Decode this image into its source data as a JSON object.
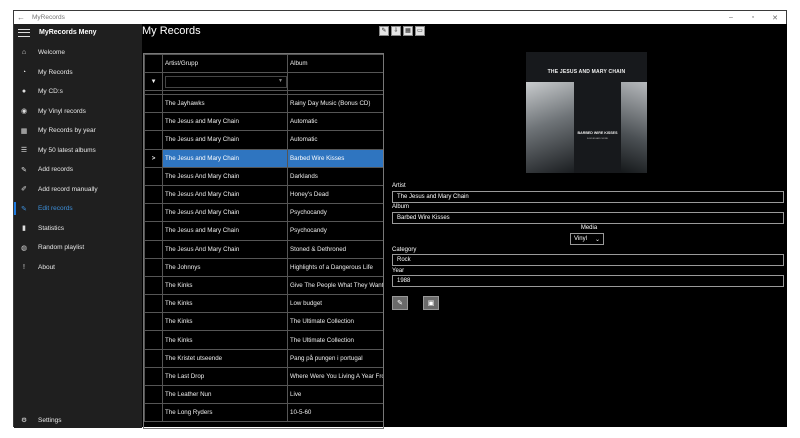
{
  "window": {
    "title": "MyRecords",
    "back_glyph": "←",
    "minimize_glyph": "–",
    "maximize_glyph": "▫",
    "close_glyph": "✕"
  },
  "sidebar": {
    "title": "MyRecords Meny",
    "items": [
      {
        "label": "Welcome",
        "icon": "home-icon",
        "glyph": "⌂"
      },
      {
        "label": "My Records",
        "icon": "records-icon",
        "glyph": "◔"
      },
      {
        "label": "My CD:s",
        "icon": "cd-icon",
        "glyph": "●"
      },
      {
        "label": "My Vinyl records",
        "icon": "vinyl-icon",
        "glyph": "◉"
      },
      {
        "label": "My Records by year",
        "icon": "calendar-icon",
        "glyph": "▦"
      },
      {
        "label": "My 50 latest albums",
        "icon": "list-icon",
        "glyph": "☰"
      },
      {
        "label": "Add records",
        "icon": "pen-icon",
        "glyph": "✎"
      },
      {
        "label": "Add record manually",
        "icon": "pencil-icon",
        "glyph": "✐"
      },
      {
        "label": "Edit records",
        "icon": "edit-icon",
        "glyph": "✎"
      },
      {
        "label": "Statistics",
        "icon": "statistics-icon",
        "glyph": "▮"
      },
      {
        "label": "Random playlist",
        "icon": "globe-icon",
        "glyph": "◍"
      },
      {
        "label": "About",
        "icon": "about-icon",
        "glyph": "!"
      }
    ],
    "active_item": "Edit records",
    "settings": {
      "label": "Settings",
      "icon": "gear-icon",
      "glyph": "⚙"
    }
  },
  "main": {
    "title": "My Records",
    "toolbar": [
      {
        "icon": "toolbar-edit-icon",
        "glyph": "✎"
      },
      {
        "icon": "toolbar-import-icon",
        "glyph": "⇩"
      },
      {
        "icon": "toolbar-grid-icon",
        "glyph": "▦"
      },
      {
        "icon": "toolbar-monitor-icon",
        "glyph": "▭"
      }
    ]
  },
  "grid": {
    "columns": [
      "Artist/Grupp",
      "Album"
    ],
    "filter_glyph": "▼",
    "current_row_glyph": ">",
    "rows": [
      {
        "artist": "The Jayhawks",
        "album": "Rainy Day Music (Bonus CD)"
      },
      {
        "artist": "The Jesus and Mary Chain",
        "album": "Automatic"
      },
      {
        "artist": "The Jesus and Mary Chain",
        "album": "Automatic"
      },
      {
        "artist": "The Jesus and Mary Chain",
        "album": "Barbed Wire Kisses"
      },
      {
        "artist": "The Jesus And Mary Chain",
        "album": "Darklands"
      },
      {
        "artist": "The Jesus And Mary Chain",
        "album": "Honey's Dead"
      },
      {
        "artist": "The Jesus And Mary Chain",
        "album": "Psychocandy"
      },
      {
        "artist": "The Jesus and Mary Chain",
        "album": "Psychocandy"
      },
      {
        "artist": "The Jesus And Mary Chain",
        "album": "Stoned & Dethroned"
      },
      {
        "artist": "The Johnnys",
        "album": "Highlights of a Dangerous Life"
      },
      {
        "artist": "The Kinks",
        "album": "Give The People What They Want"
      },
      {
        "artist": "The Kinks",
        "album": "Low budget"
      },
      {
        "artist": "The Kinks",
        "album": "The Ultimate Collection"
      },
      {
        "artist": "The Kinks",
        "album": "The Ultimate Collection"
      },
      {
        "artist": "The Kristet utseende",
        "album": "Pang på pungen i portugal"
      },
      {
        "artist": "The Last Drop",
        "album": "Where Were You Living A Year From Now"
      },
      {
        "artist": "The Leather Nun",
        "album": "Live"
      },
      {
        "artist": "The Long Ryders",
        "album": "10-5-60"
      }
    ],
    "selected_index": 3
  },
  "details": {
    "cover": {
      "band_text": "THE JESUS AND MARY CHAIN",
      "album_text": "BARBED WIRE KISSES",
      "sub_text": "B-SIDES AND MORE"
    },
    "artist_label": "Artist",
    "artist_value": "The Jesus and Mary Chain",
    "album_label": "Album",
    "album_value": "Barbed Wire Kisses",
    "media_label": "Media",
    "media_value": "Vinyl",
    "media_arrow": "⌄",
    "category_label": "Category",
    "category_value": "Rock",
    "year_label": "Year",
    "year_value": "1988",
    "buttons": [
      {
        "icon": "edit-image-icon",
        "glyph": "✎"
      },
      {
        "icon": "picture-icon",
        "glyph": "▣"
      }
    ]
  }
}
